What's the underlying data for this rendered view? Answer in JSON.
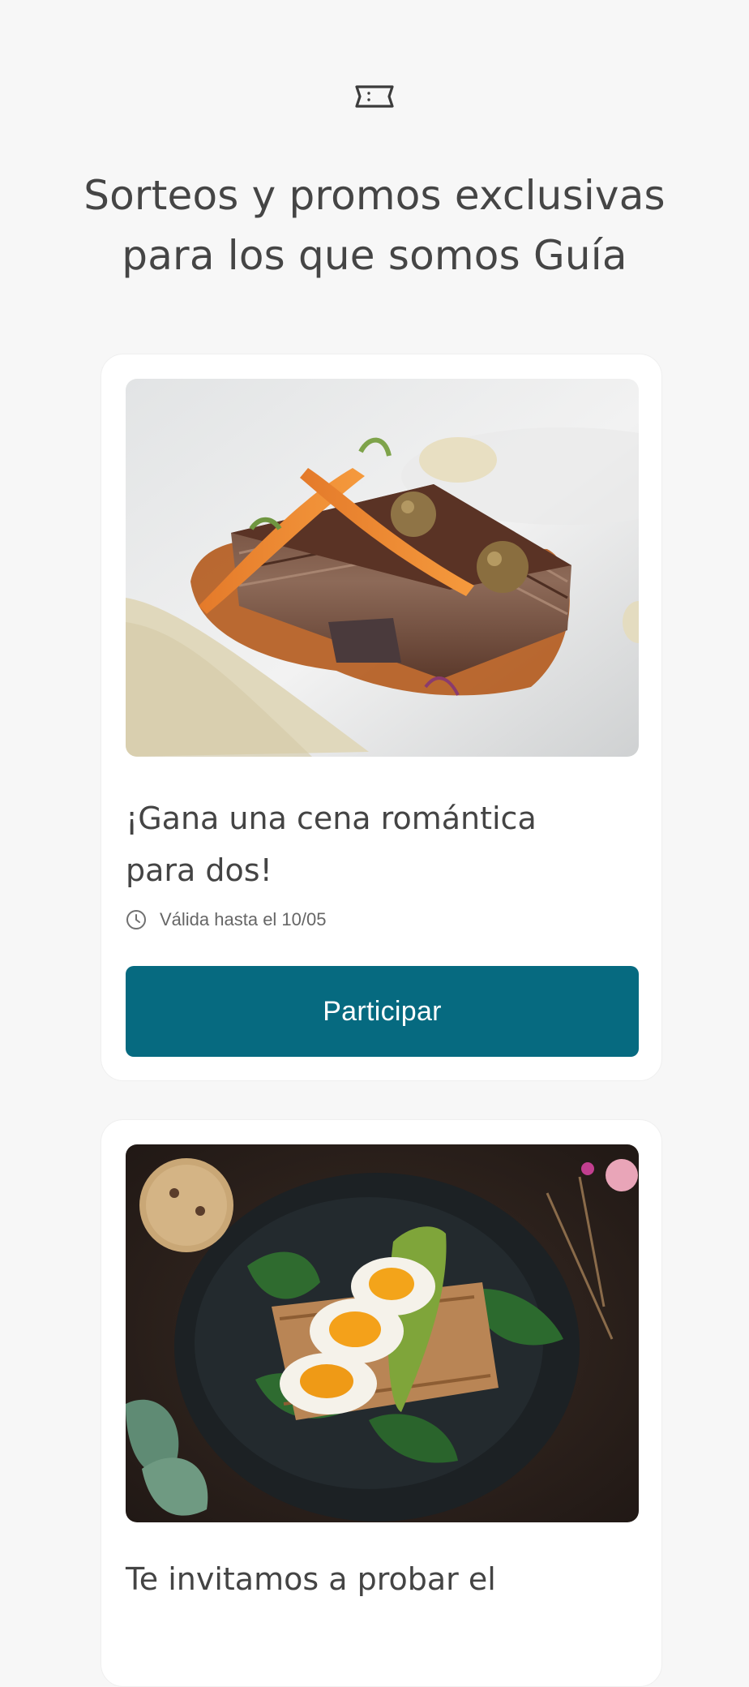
{
  "header": {
    "icon": "ticket-icon",
    "title": "Sorteos y promos exclusivas para los que somos Guía"
  },
  "promos": [
    {
      "image": "plated-dish-with-carrots",
      "title": "¡Gana una cena  romántica para dos!",
      "validity_icon": "clock-icon",
      "validity": "Válida hasta el 10/05",
      "button_label": "Participar"
    },
    {
      "image": "toast-with-eggs-and-avocado",
      "title": "Te invitamos a probar el"
    }
  ],
  "colors": {
    "background": "#f7f7f7",
    "card": "#ffffff",
    "button": "#066a80",
    "title_text": "#454545",
    "muted_text": "#666666"
  }
}
